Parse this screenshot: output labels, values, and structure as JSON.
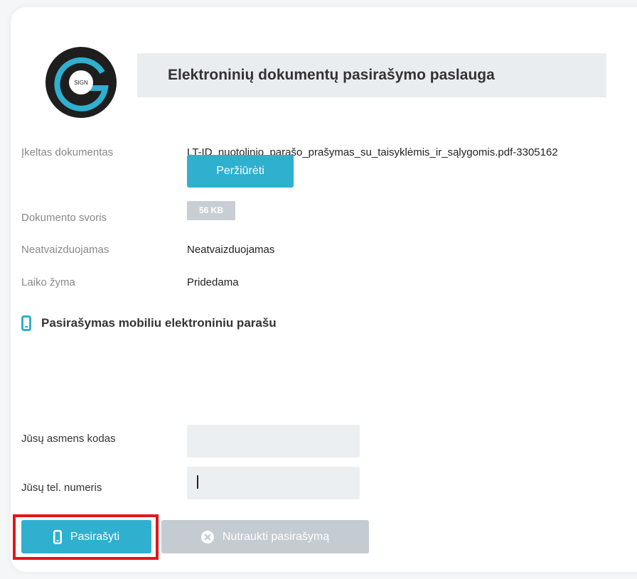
{
  "header": {
    "logo_text": "SIGN",
    "title": "Elektroninių dokumentų pasirašymo paslauga"
  },
  "document": {
    "uploaded_label": "Įkeltas dokumentas",
    "filename": "LT-ID_nuotolinio_parašo_prašymas_su_taisyklėmis_ir_sąlygomis.pdf-3305162",
    "view_button": "Peržiūrėti",
    "size_label": "Dokumento svoris",
    "size_value": "56 KB",
    "display_label": "Neatvaizduojamas",
    "display_value": "Neatvaizduojamas",
    "timestamp_label": "Laiko žyma",
    "timestamp_value": "Pridedama"
  },
  "signing": {
    "section_title": "Pasirašymas mobiliu elektroniniu parašu",
    "personal_code_label": "Jūsų asmens kodas",
    "personal_code_value": "",
    "phone_label": "Jūsų tel. numeris",
    "phone_value": "",
    "sign_button": "Pasirašyti",
    "cancel_button": "Nutraukti pasirašymą"
  },
  "colors": {
    "accent": "#2fb0cf",
    "disabled": "#c4cbd1",
    "highlight": "#e0161b"
  },
  "icons": {
    "logo": "gsign-logo-icon",
    "section": "mobile-phone-icon",
    "sign": "mobile-phone-icon",
    "cancel": "close-circle-icon"
  }
}
